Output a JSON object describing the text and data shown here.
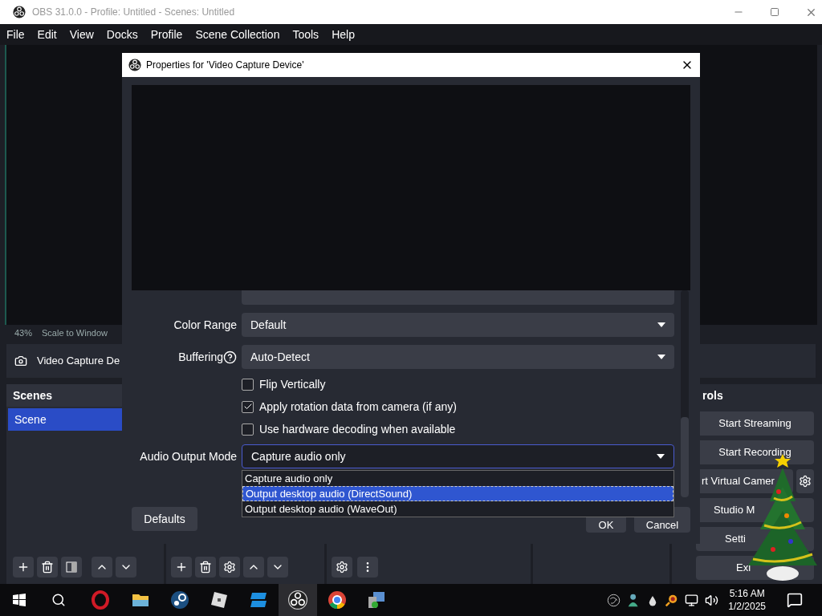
{
  "window": {
    "title": "OBS 31.0.0 - Profile: Untitled - Scenes: Untitled"
  },
  "menu": [
    "File",
    "Edit",
    "View",
    "Docks",
    "Profile",
    "Scene Collection",
    "Tools",
    "Help"
  ],
  "preview_status": {
    "zoom": "43%",
    "scale": "Scale to Window"
  },
  "source_bar": {
    "name": "Video Capture De"
  },
  "scenes": {
    "title": "Scenes",
    "items": [
      {
        "label": "Scene",
        "selected": true
      }
    ]
  },
  "controls": {
    "title": "rols",
    "buttons": [
      "Start Streaming",
      "Start Recording",
      "rt Virtual Camer",
      "Studio M",
      "Setti",
      "Exi"
    ]
  },
  "dialog": {
    "title": "Properties for 'Video Capture Device'",
    "fields": [
      {
        "kind": "select",
        "label": "Color Range",
        "value": "Default",
        "help": false
      },
      {
        "kind": "select",
        "label": "Buffering",
        "value": "Auto-Detect",
        "help": true
      },
      {
        "kind": "checkbox",
        "label": "Flip Vertically",
        "checked": false
      },
      {
        "kind": "checkbox",
        "label": "Apply rotation data from camera (if any)",
        "checked": true
      },
      {
        "kind": "checkbox",
        "label": "Use hardware decoding when available",
        "checked": false
      },
      {
        "kind": "select",
        "label": "Audio Output Mode",
        "value": "Capture audio only",
        "help": false
      }
    ],
    "dropdown": [
      {
        "label": "Capture audio only",
        "selected": false
      },
      {
        "label": "Output desktop audio (DirectSound)",
        "selected": true
      },
      {
        "label": "Output desktop audio (WaveOut)",
        "selected": false
      }
    ],
    "defaults": "Defaults",
    "ok": "OK",
    "cancel": "Cancel"
  },
  "taskbar": {
    "time": "5:16 AM",
    "date": "1/2/2025"
  }
}
